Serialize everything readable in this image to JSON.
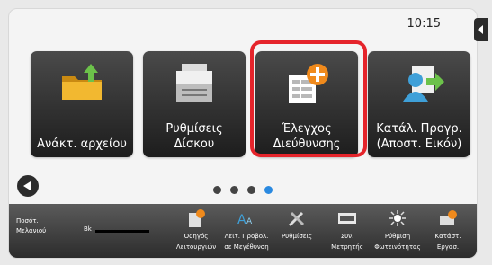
{
  "status_bar": {
    "time": "10:15"
  },
  "tiles": [
    {
      "label": "Ανάκτ. αρχείου",
      "icon": "folder-retrieve-icon"
    },
    {
      "label": "Ρυθμίσεις\nΔίσκου",
      "icon": "printer-icon"
    },
    {
      "label": "Έλεγχος\nΔιεύθυνσης",
      "icon": "address-check-icon"
    },
    {
      "label": "Κατάλ. Προγρ.\n(Αποστ. Εικόν)",
      "icon": "contact-list-icon"
    }
  ],
  "pagination": {
    "pages": 4,
    "active_index": 3
  },
  "bottom_bar": {
    "toner_label": "Ποσότ.\nΜελανιού",
    "toner_color": "Bk",
    "items": [
      {
        "label": "Οδηγός\nΛειτουργιών",
        "icon": "guide-icon"
      },
      {
        "label": "Λειτ. Προβολ.\nσε Μεγέθυνση",
        "icon": "magnify-mode-icon"
      },
      {
        "label": "Ρυθμίσεις",
        "icon": "settings-tools-icon"
      },
      {
        "label": "Συν.\nΜετρητής",
        "icon": "counter-icon"
      },
      {
        "label": "Ρύθμιση\nΦωτεινότητας",
        "icon": "brightness-icon"
      },
      {
        "label": "Κατάστ.\nΕργασ.",
        "icon": "job-status-icon"
      }
    ]
  },
  "colors": {
    "highlight": "#e5242b",
    "active_dot": "#2a89e0"
  }
}
